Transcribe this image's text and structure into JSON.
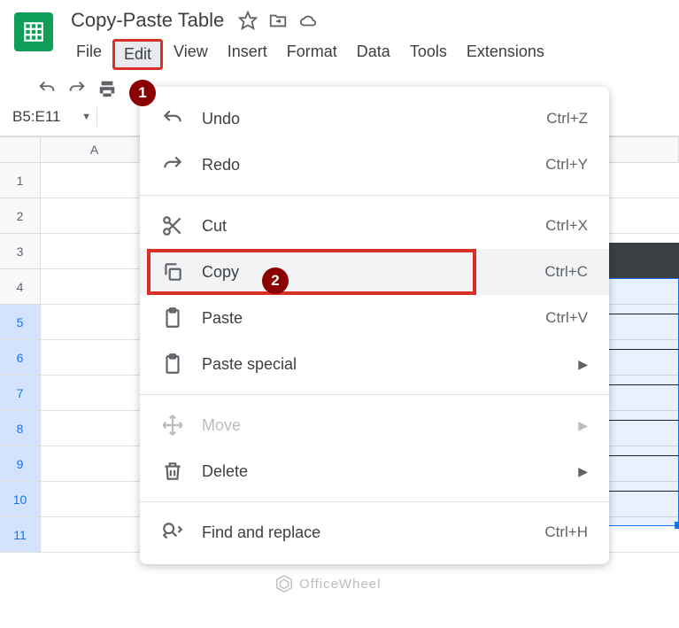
{
  "doc_title": "Copy-Paste Table",
  "menubar": [
    "File",
    "Edit",
    "View",
    "Insert",
    "Format",
    "Data",
    "Tools",
    "Extensions"
  ],
  "active_menu_index": 1,
  "namebox": "B5:E11",
  "columns": [
    "A"
  ],
  "rows": [
    "1",
    "2",
    "3",
    "4",
    "5",
    "6",
    "7",
    "8",
    "9",
    "10",
    "11"
  ],
  "selected_rows": [
    5,
    6,
    7,
    8,
    9,
    10,
    11
  ],
  "dropdown": {
    "undo": {
      "label": "Undo",
      "shortcut": "Ctrl+Z"
    },
    "redo": {
      "label": "Redo",
      "shortcut": "Ctrl+Y"
    },
    "cut": {
      "label": "Cut",
      "shortcut": "Ctrl+X"
    },
    "copy": {
      "label": "Copy",
      "shortcut": "Ctrl+C"
    },
    "paste": {
      "label": "Paste",
      "shortcut": "Ctrl+V"
    },
    "paste_special": {
      "label": "Paste special"
    },
    "move": {
      "label": "Move"
    },
    "delete": {
      "label": "Delete"
    },
    "find": {
      "label": "Find and replace",
      "shortcut": "Ctrl+H"
    }
  },
  "badges": {
    "b1": "1",
    "b2": "2"
  },
  "watermark": "OfficeWheel"
}
